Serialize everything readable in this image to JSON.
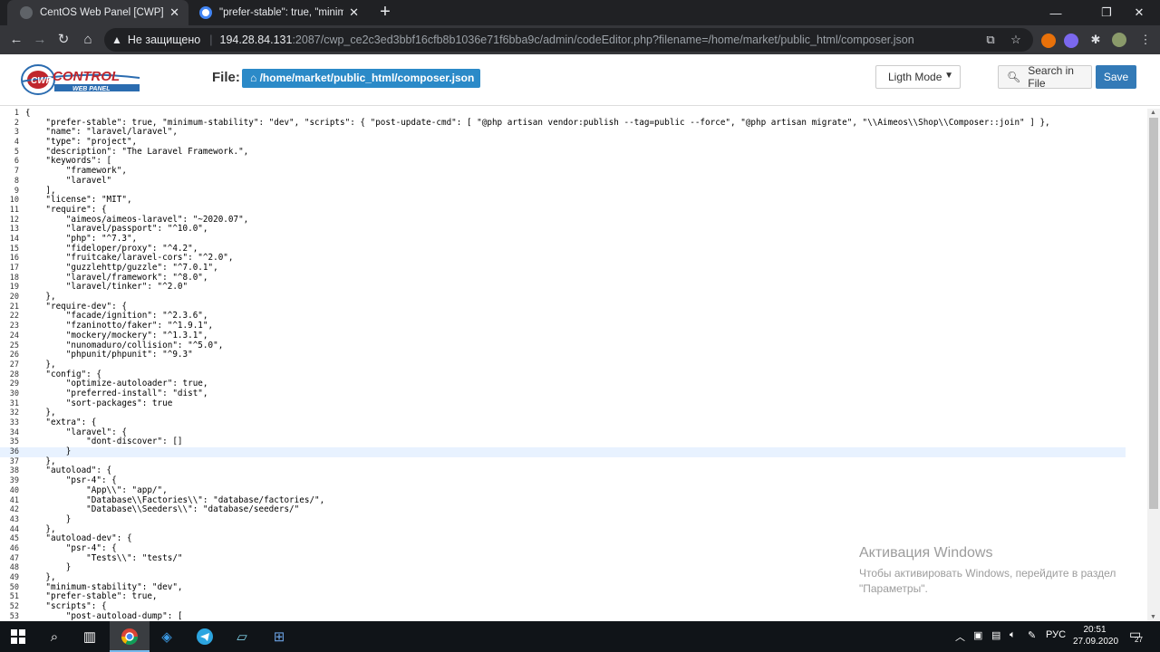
{
  "browser": {
    "tabs": [
      {
        "title": "CentOS Web Panel [CWP] - Edito",
        "active": true
      },
      {
        "title": "\"prefer-stable\": true, \"minimum-s",
        "active": false
      }
    ],
    "url_warning": "Не защищено",
    "url_host": "194.28.84.131",
    "url_path": ":2087/cwp_ce2c3ed3bbf16cfb8b1036e71f6bba9c/admin/codeEditor.php?filename=/home/market/public_html/composer.json"
  },
  "header": {
    "logo_text": "CWPCONTROL",
    "logo_sub": "WEB PANEL",
    "file_label": "File:",
    "file_path": "/home/market/public_html/composer.json",
    "mode_select": "Ligth Mode",
    "search_button": "Search in File",
    "save_button": "Save"
  },
  "editor": {
    "active_line": 36,
    "lines": [
      "{",
      "    \"prefer-stable\": true, \"minimum-stability\": \"dev\", \"scripts\": { \"post-update-cmd\": [ \"@php artisan vendor:publish --tag=public --force\", \"@php artisan migrate\", \"\\\\Aimeos\\\\Shop\\\\Composer::join\" ] },",
      "    \"name\": \"laravel/laravel\",",
      "    \"type\": \"project\",",
      "    \"description\": \"The Laravel Framework.\",",
      "    \"keywords\": [",
      "        \"framework\",",
      "        \"laravel\"",
      "    ],",
      "    \"license\": \"MIT\",",
      "    \"require\": {",
      "        \"aimeos/aimeos-laravel\": \"~2020.07\",",
      "        \"laravel/passport\": \"^10.0\",",
      "        \"php\": \"^7.3\",",
      "        \"fideloper/proxy\": \"^4.2\",",
      "        \"fruitcake/laravel-cors\": \"^2.0\",",
      "        \"guzzlehttp/guzzle\": \"^7.0.1\",",
      "        \"laravel/framework\": \"^8.0\",",
      "        \"laravel/tinker\": \"^2.0\"",
      "    },",
      "    \"require-dev\": {",
      "        \"facade/ignition\": \"^2.3.6\",",
      "        \"fzaninotto/faker\": \"^1.9.1\",",
      "        \"mockery/mockery\": \"^1.3.1\",",
      "        \"nunomaduro/collision\": \"^5.0\",",
      "        \"phpunit/phpunit\": \"^9.3\"",
      "    },",
      "    \"config\": {",
      "        \"optimize-autoloader\": true,",
      "        \"preferred-install\": \"dist\",",
      "        \"sort-packages\": true",
      "    },",
      "    \"extra\": {",
      "        \"laravel\": {",
      "            \"dont-discover\": []",
      "        }",
      "    },",
      "    \"autoload\": {",
      "        \"psr-4\": {",
      "            \"App\\\\\": \"app/\",",
      "            \"Database\\\\Factories\\\\\": \"database/factories/\",",
      "            \"Database\\\\Seeders\\\\\": \"database/seeders/\"",
      "        }",
      "    },",
      "    \"autoload-dev\": {",
      "        \"psr-4\": {",
      "            \"Tests\\\\\": \"tests/\"",
      "        }",
      "    },",
      "    \"minimum-stability\": \"dev\",",
      "    \"prefer-stable\": true,",
      "    \"scripts\": {",
      "        \"post-autoload-dump\": ["
    ]
  },
  "watermark": {
    "title": "Активация Windows",
    "line1": "Чтобы активировать Windows, перейдите в раздел",
    "line2": "\"Параметры\"."
  },
  "taskbar": {
    "language": "РУС",
    "time": "20:51",
    "date": "27.09.2020",
    "notifications": "27"
  }
}
